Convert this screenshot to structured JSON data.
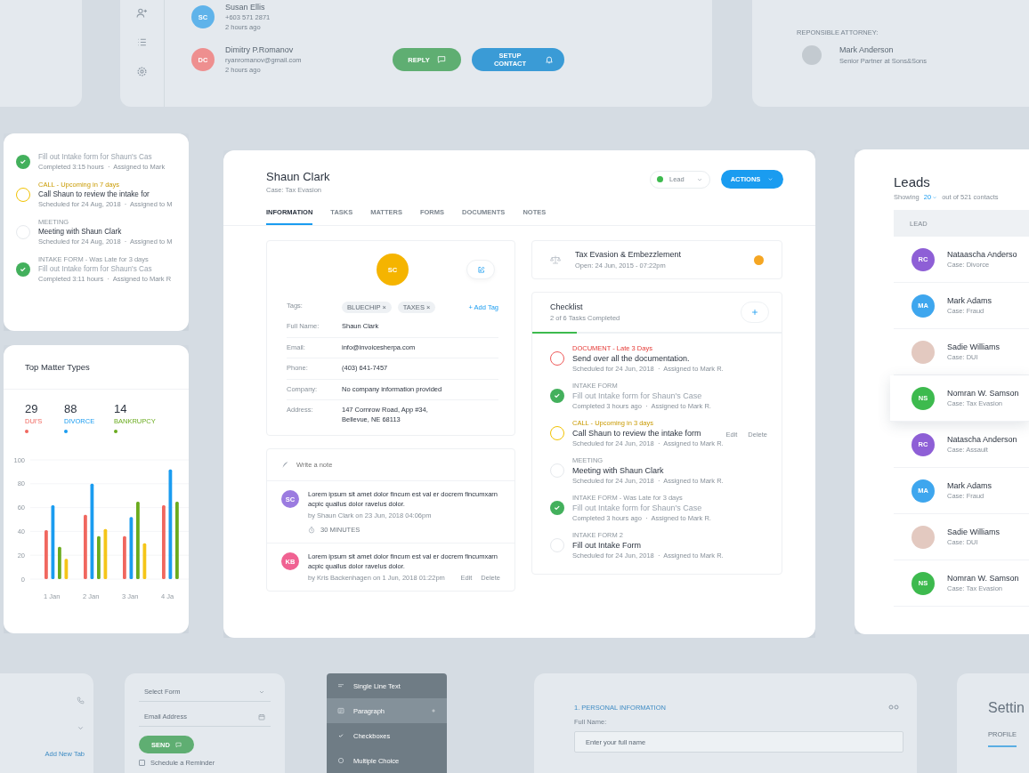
{
  "contacts_card": {
    "contacts": [
      {
        "initials": "SC",
        "color": "#5fb3ea",
        "name": "Susan Ellis",
        "detail": "+603 571 2871",
        "time": "2 hours ago"
      },
      {
        "initials": "DC",
        "color": "#ee8f8f",
        "name": "Dimitry P.Romanov",
        "detail": "ryanromanov@gmail.com",
        "time": "2 hours ago"
      }
    ],
    "buttons": [
      {
        "label": "REPLY",
        "kind": "reply"
      },
      {
        "label": "SETUP CONTACT",
        "kind": "setup"
      }
    ]
  },
  "attorney_card": {
    "heading": "REPONSIBLE ATTORNEY:",
    "name": "Mark Anderson",
    "role": "Senior Partner at Sons&Sons"
  },
  "task_card": {
    "tasks": [
      {
        "kind": "done",
        "title": "Fill out Intake form for Shaun's Cas",
        "meta": "Completed 3:15 hours  ·  Assigned to Mark"
      },
      {
        "kind": "upcoming",
        "label": "CALL - Upcoming in 7 days",
        "title": "Call Shaun to review the intake for",
        "meta": "Scheduled for 24 Aug, 2018  ·  Assigned to M"
      },
      {
        "kind": "open",
        "label": "MEETING",
        "title": "Meeting with Shaun Clark",
        "meta": "Scheduled for 24 Aug, 2018  ·  Assigned to M"
      },
      {
        "kind": "done",
        "label": "INTAKE FORM - Was Late for 3 days",
        "title": "Fill out Intake form for Shaun's Cas",
        "meta": "Completed 3:11 hours  ·  Assigned to Mark R"
      }
    ]
  },
  "matter_types_card": {
    "title": "Top Matter Types",
    "stats": [
      {
        "value": "29",
        "label": "DUI'S",
        "color": "#f0675f"
      },
      {
        "value": "88",
        "label": "DIVORCE",
        "color": "#1a9cf0"
      },
      {
        "value": "14",
        "label": "BANKRUPCY",
        "color": "#6aab1e"
      }
    ],
    "chart_data": {
      "type": "bar",
      "grid": true,
      "categories": [
        "1 Jan",
        "2 Jan",
        "3 Jan",
        "4 Ja"
      ],
      "ylim": [
        0,
        100
      ],
      "yticks": [
        0,
        20,
        40,
        60,
        80,
        100
      ],
      "series": [
        {
          "color": "#f0675f",
          "values": [
            41,
            54,
            36,
            62
          ]
        },
        {
          "color": "#1a9cf0",
          "values": [
            62,
            80,
            52,
            92
          ]
        },
        {
          "color": "#6aab1e",
          "values": [
            27,
            36,
            65,
            65
          ]
        },
        {
          "color": "#f5c518",
          "values": [
            17,
            42,
            30,
            null
          ]
        }
      ]
    }
  },
  "contact_card": {
    "name": "Shaun Clark",
    "case": "Case: Tax Evasion",
    "status": {
      "label": "Lead",
      "color": "#3dba4e"
    },
    "actions_label": "ACTIONS",
    "tabs": [
      {
        "label": "INFORMATION",
        "selected": true
      },
      {
        "label": "TASKS",
        "selected": false
      },
      {
        "label": "MATTERS",
        "selected": false
      },
      {
        "label": "FORMS",
        "selected": false
      },
      {
        "label": "DOCUMENTS",
        "selected": false
      },
      {
        "label": "NOTES",
        "selected": false
      }
    ],
    "profile": {
      "initials": "SC",
      "color": "#f5b400",
      "tags_label": "Tags:",
      "tags": [
        "BLUECHIP ×",
        "TAXES ×"
      ],
      "add_tag": "+ Add Tag",
      "fields": [
        {
          "label": "Full Name:",
          "value": "Shaun Clark"
        },
        {
          "label": "Email:",
          "value": "info@invoicesherpa.com"
        },
        {
          "label": "Phone:",
          "value": "(403) 641-7457"
        },
        {
          "label": "Company:",
          "value": "No company information provided"
        },
        {
          "label": "Address:",
          "value": "147 Cornrow Road, App #34,\nBellevue, NE 68113"
        }
      ]
    },
    "notes": {
      "placeholder": "Write a note",
      "items": [
        {
          "initials": "SC",
          "color": "#9b7be0",
          "text": "Lorem ipsum sit amet dolor fincum est val er docrem fincumxarn acpic quallus dolor ravelus dolor.",
          "meta": "by Shaun Clark on 23 Jun, 2018 04:06pm",
          "duration": "30 MINUTES"
        },
        {
          "initials": "KB",
          "color": "#f06292",
          "text": "Lorem ipsum sit amet dolor fincum est val er docrem fincumxarn acpic quallus dolor ravelus dolor.",
          "meta": "by Kris Backenhagen on 1 Jun, 2018 01:22pm",
          "actions": [
            "Edit",
            "Delete"
          ]
        }
      ]
    },
    "matter": {
      "title": "Tax Evasion & Embezzlement",
      "opened": "Open: 24 Jun, 2015 - 07:22pm",
      "color": "#f5a623"
    },
    "checklist": {
      "title": "Checklist",
      "summary": "2 of 6 Tasks Completed",
      "level": 0.18,
      "tasks": [
        {
          "kind": "late",
          "label": "DOCUMENT - Late 3 Days",
          "title": "Send over all the documentation.",
          "meta": "Scheduled for 24 Jun, 2018  ·  Assigned to Mark R."
        },
        {
          "kind": "done",
          "label": "INTAKE FORM",
          "title": "Fill out Intake form for Shaun's Case",
          "meta": "Completed 3 hours ago  ·  Assigned to Mark R."
        },
        {
          "kind": "upcoming",
          "label": "CALL - Upcoming in 3 days",
          "title": "Call Shaun to review the intake form",
          "meta": "Scheduled for 24 Jun, 2018  ·  Assigned to Mark R.",
          "actions": [
            "Edit",
            "Delete"
          ]
        },
        {
          "kind": "open",
          "label": "MEETING",
          "title": "Meeting with Shaun Clark",
          "meta": "Scheduled for 24 Jun, 2018  ·  Assigned to Mark R."
        },
        {
          "kind": "done",
          "label": "INTAKE FORM - Was Late for 3 days",
          "title": "Fill out Intake form for Shaun's Case",
          "meta": "Completed 3 hours ago  ·  Assigned to Mark R."
        },
        {
          "kind": "open",
          "label": "INTAKE FORM 2",
          "title": "Fill out Intake Form",
          "meta": "Scheduled for 24 Jun, 2018  ·  Assigned to Mark R."
        }
      ]
    }
  },
  "leads_card": {
    "title": "Leads",
    "showing": "Showing",
    "count": "20",
    "total": "out of 521 contacts",
    "column": "LEAD",
    "rows": [
      {
        "kind": "initials",
        "initials": "RC",
        "color": "#8e5fd6",
        "name": "Nataascha Anderso",
        "case": "Case: Divorce",
        "selected": false
      },
      {
        "kind": "initials",
        "initials": "MA",
        "color": "#3ea6ee",
        "name": "Mark Adams",
        "case": "Case: Fraud",
        "selected": false
      },
      {
        "kind": "photo",
        "name": "Sadie Williams",
        "case": "Case: DUI",
        "selected": false
      },
      {
        "kind": "initials",
        "initials": "NS",
        "color": "#3dba4e",
        "name": "Nomran W. Samson",
        "case": "Case: Tax Evasion",
        "selected": true
      },
      {
        "kind": "initials",
        "initials": "RC",
        "color": "#8e5fd6",
        "name": "Natascha Anderson",
        "case": "Case: Assault",
        "selected": false
      },
      {
        "kind": "initials",
        "initials": "MA",
        "color": "#3ea6ee",
        "name": "Mark Adams",
        "case": "Case: Fraud",
        "selected": false
      },
      {
        "kind": "photo",
        "name": "Sadie Williams",
        "case": "Case: DUI",
        "selected": false
      },
      {
        "kind": "initials",
        "initials": "NS",
        "color": "#3dba4e",
        "name": "Nomran W. Samson",
        "case": "Case: Tax Evasion",
        "selected": false
      }
    ]
  },
  "phone_card": {
    "link": "Add New Tab"
  },
  "send_form_card": {
    "select_placeholder": "Select Form",
    "email_placeholder": "Email Address",
    "send": "SEND",
    "reminder": {
      "label": "Schedule a Reminder",
      "checked": false
    }
  },
  "field_types_panel": {
    "items": [
      {
        "kind": "text",
        "label": "Single Line Text",
        "selected": false
      },
      {
        "kind": "paragraph",
        "label": "Paragraph",
        "selected": true
      },
      {
        "kind": "checkbox",
        "label": "Checkboxes",
        "selected": false
      },
      {
        "kind": "radio",
        "label": "Multiple Choice",
        "selected": false
      }
    ]
  },
  "personal_form_card": {
    "section": "1. PERSONAL INFORMATION",
    "field_label": "Full Name:",
    "placeholder": "Enter your full name"
  },
  "settings_card": {
    "title": "Settin",
    "tabs": [
      {
        "label": "PROFILE",
        "selected": true
      }
    ]
  }
}
